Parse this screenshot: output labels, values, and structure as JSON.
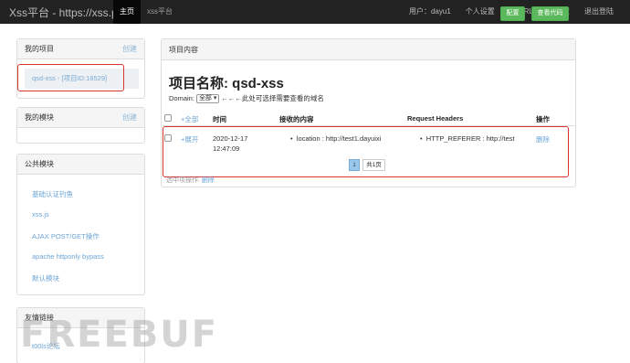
{
  "navbar": {
    "brand": "Xss平台 - https://xss.pt",
    "left_items": [
      "主页",
      "xss平台"
    ],
    "right_items": [
      "用户：dayu1",
      "个人设置",
      "IP-URL黑名单设置",
      "退出登陆"
    ]
  },
  "sidebar": {
    "my_projects": {
      "title": "我的项目",
      "action": "创建",
      "items": [
        "qsd-xss - [项目ID:18529]"
      ]
    },
    "my_modules": {
      "title": "我的模块",
      "action": "创建"
    },
    "public_modules": {
      "title": "公共模块",
      "items": [
        "基础认证钓鱼",
        "xss.js",
        "AJAX POST/GET操作",
        "apache httponly bypass",
        "默认模块"
      ]
    },
    "friend_links": {
      "title": "友情链接",
      "items": [
        "t00ls论坛"
      ]
    }
  },
  "main": {
    "header": "项目内容",
    "config_button": "配置",
    "view_code_button": "查看代码",
    "project_title": "项目名称: qsd-xss",
    "domain_label": "Domain:",
    "domain_value": "全部",
    "domain_hint": "←←←此处可选择需要查看的域名",
    "table_headers": {
      "expand_all": "+全部",
      "time": "时间",
      "content": "接收的内容",
      "headers": "Request Headers",
      "ops": "操作"
    },
    "row": {
      "expand": "+展开",
      "date": "2020-12-17",
      "time": "12:47:09",
      "content": "location : http://test1.dayuixi",
      "header": "HTTP_REFERER : http://test",
      "delete": "删除"
    },
    "pagination": {
      "current": "1",
      "total": "共1页"
    },
    "selected_ops_label": "选中项操作:",
    "selected_ops_delete": "删除"
  },
  "watermark": "FREEBUF"
}
